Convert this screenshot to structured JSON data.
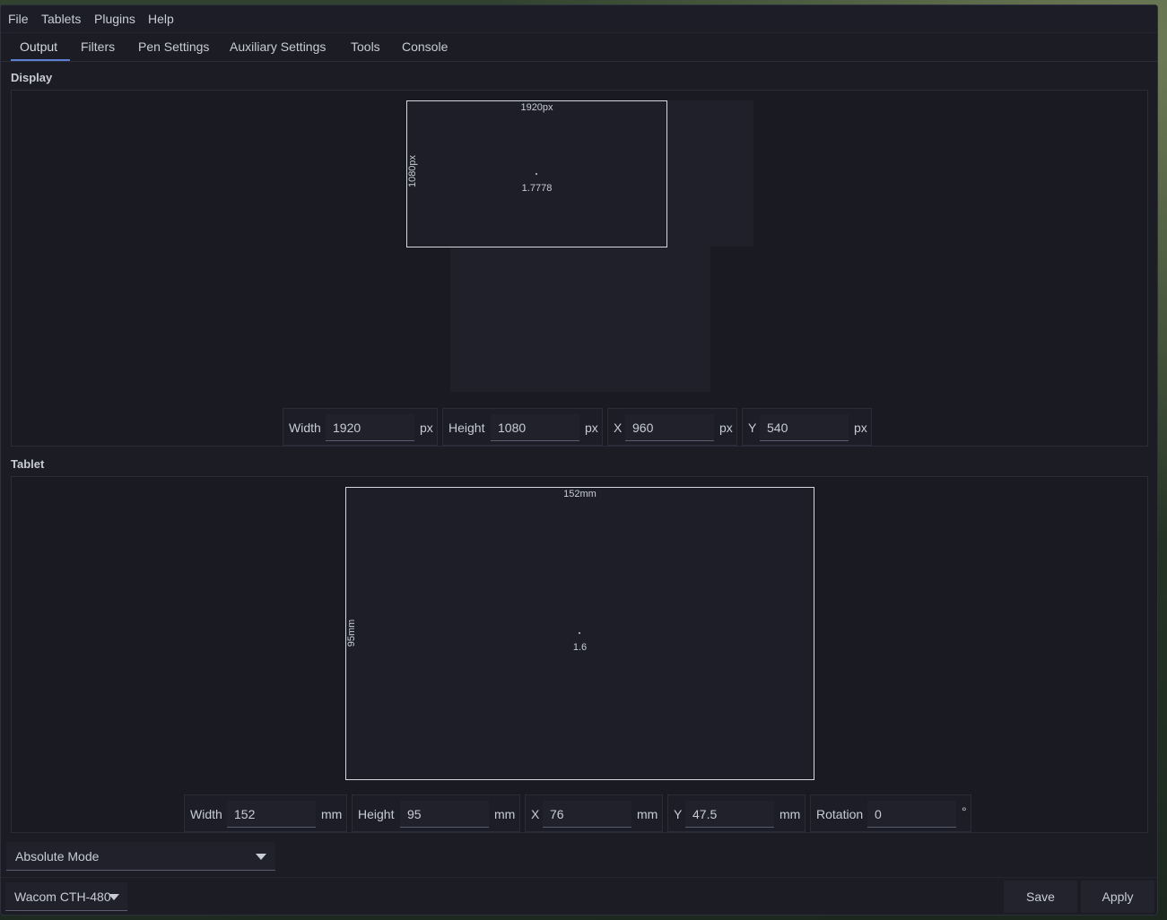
{
  "menu": [
    "File",
    "Tablets",
    "Plugins",
    "Help"
  ],
  "tabs": [
    "Output",
    "Filters",
    "Pen Settings",
    "Auxiliary Settings",
    "Tools",
    "Console"
  ],
  "display": {
    "title": "Display",
    "area_width_label": "1920px",
    "area_height_label": "1080px",
    "aspect_label": "1.7778",
    "fields": {
      "width_label": "Width",
      "width_value": "1920",
      "width_unit": "px",
      "height_label": "Height",
      "height_value": "1080",
      "height_unit": "px",
      "x_label": "X",
      "x_value": "960",
      "x_unit": "px",
      "y_label": "Y",
      "y_value": "540",
      "y_unit": "px"
    }
  },
  "tablet": {
    "title": "Tablet",
    "area_width_label": "152mm",
    "area_height_label": "95mm",
    "aspect_label": "1.6",
    "fields": {
      "width_label": "Width",
      "width_value": "152",
      "width_unit": "mm",
      "height_label": "Height",
      "height_value": "95",
      "height_unit": "mm",
      "x_label": "X",
      "x_value": "76",
      "x_unit": "mm",
      "y_label": "Y",
      "y_value": "47.5",
      "y_unit": "mm",
      "rotation_label": "Rotation",
      "rotation_value": "0",
      "rotation_unit": "°"
    }
  },
  "mode_select": "Absolute Mode",
  "tablet_select": "Wacom CTH-480",
  "buttons": {
    "save": "Save",
    "apply": "Apply"
  },
  "colors": {
    "accent": "#5e7fd1",
    "window_bg": "#1b1c24"
  }
}
